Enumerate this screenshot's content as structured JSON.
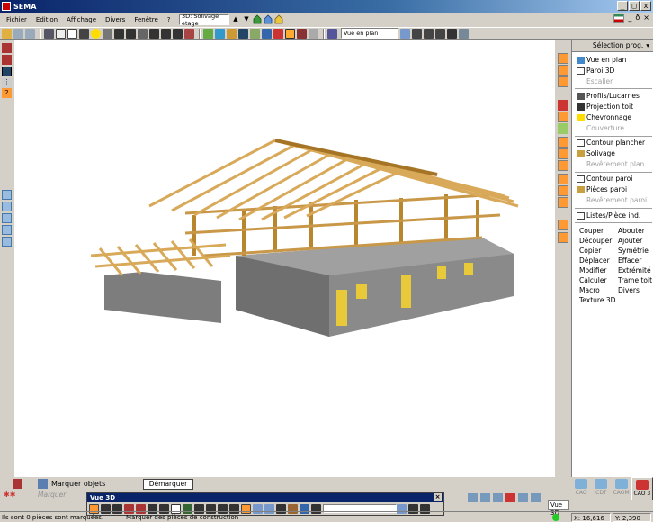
{
  "app": {
    "title": "SEMA"
  },
  "menu": {
    "items": [
      "Fichier",
      "Edition",
      "Affichage",
      "Divers",
      "Fenêtre",
      "?"
    ]
  },
  "view_selector": {
    "value": "3D: Solivage etage"
  },
  "toolbar": {
    "view_combo": "Vue en plan"
  },
  "window_controls": {
    "min": "_",
    "max": "□",
    "close": "x",
    "doc_min": "_",
    "doc_restore": "ð",
    "doc_close": "×"
  },
  "left_tools": {
    "counter": "2"
  },
  "right_panel": {
    "header": "Sélection prog.",
    "items": [
      {
        "label": "Vue en plan",
        "enabled": true
      },
      {
        "label": "Paroi 3D",
        "enabled": true
      },
      {
        "label": "Escalier",
        "enabled": false
      },
      {
        "label": "Profils/Lucarnes",
        "enabled": true
      },
      {
        "label": "Projection toit",
        "enabled": true
      },
      {
        "label": "Chevronnage",
        "enabled": true
      },
      {
        "label": "Couverture",
        "enabled": false
      },
      {
        "label": "Contour plancher",
        "enabled": true
      },
      {
        "label": "Solivage",
        "enabled": true
      },
      {
        "label": "Revêtement plan.",
        "enabled": false
      },
      {
        "label": "Contour paroi",
        "enabled": true
      },
      {
        "label": "Pièces paroi",
        "enabled": true
      },
      {
        "label": "Revêtement paroi",
        "enabled": false
      },
      {
        "label": "Listes/Pièce ind.",
        "enabled": true
      }
    ],
    "commands_left": [
      "Couper",
      "Découper",
      "Copier",
      "Déplacer",
      "Modifier",
      "Calculer",
      "Macro",
      "Texture 3D"
    ],
    "commands_right": [
      "Abouter",
      "Ajouter",
      "Symétrie",
      "Effacer",
      "Extrémité",
      "Trame toit",
      "Divers"
    ],
    "search_value": "Vue 3D"
  },
  "cad_buttons": [
    {
      "label": "CAO",
      "active": false
    },
    {
      "label": "CDT",
      "active": false
    },
    {
      "label": "CAOM",
      "active": false
    },
    {
      "label": "CAO 3",
      "active": true
    }
  ],
  "bottom": {
    "marquer_label": "Marquer objets",
    "demarquer_button": "Démarquer",
    "marquer_repeat": "Marquer"
  },
  "vue3d_toolbar": {
    "title": "Vue 3D",
    "combo": "---"
  },
  "status": {
    "message": "Ils sont 0 pièces sont marquées.",
    "hint": "Marquer des pièces de construction",
    "x": "X: 16,616",
    "y": "Y: 2,390"
  }
}
